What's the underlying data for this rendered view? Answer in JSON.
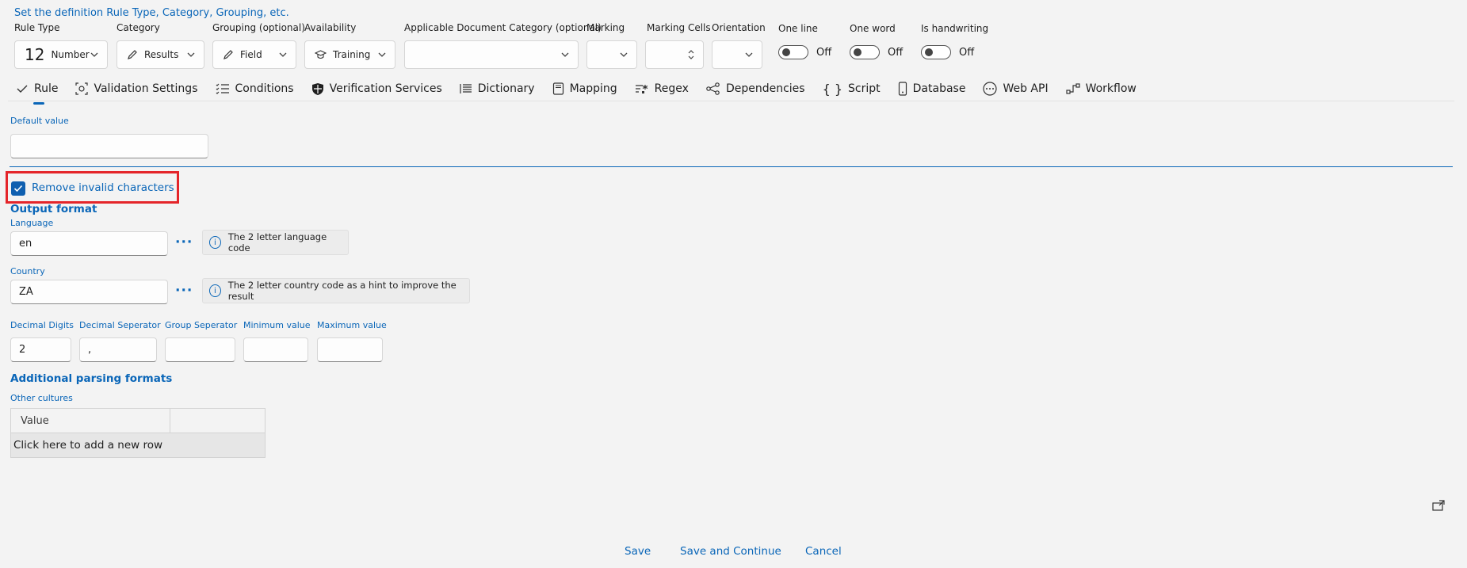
{
  "header": {
    "title": "Set the definition Rule Type, Category, Grouping, etc."
  },
  "fields": {
    "rule_type": {
      "label": "Rule Type",
      "value": "Number",
      "icon": "number-12-icon"
    },
    "category": {
      "label": "Category",
      "value": "Results",
      "icon": "pencil-icon"
    },
    "grouping": {
      "label": "Grouping (optional)",
      "value": "Field",
      "icon": "pencil-icon"
    },
    "availability": {
      "label": "Availability",
      "value": "Training",
      "icon": "graduation-cap-icon"
    },
    "doc_category": {
      "label": "Applicable Document Category (optional)",
      "value": ""
    },
    "marking": {
      "label": "Marking",
      "value": ""
    },
    "marking_cells": {
      "label": "Marking Cells",
      "value": ""
    },
    "orientation": {
      "label": "Orientation",
      "value": ""
    },
    "one_line": {
      "label": "One line",
      "state": "Off"
    },
    "one_word": {
      "label": "One word",
      "state": "Off"
    },
    "handwriting": {
      "label": "Is handwriting",
      "state": "Off"
    }
  },
  "tabs": [
    {
      "label": "Rule",
      "icon": "check-icon",
      "active": true
    },
    {
      "label": "Validation Settings",
      "icon": "validation-icon"
    },
    {
      "label": "Conditions",
      "icon": "list-check-icon"
    },
    {
      "label": "Verification Services",
      "icon": "shield-icon"
    },
    {
      "label": "Dictionary",
      "icon": "list-icon"
    },
    {
      "label": "Mapping",
      "icon": "book-icon"
    },
    {
      "label": "Regex",
      "icon": "regex-icon"
    },
    {
      "label": "Dependencies",
      "icon": "share-icon"
    },
    {
      "label": "Script",
      "icon": "braces-icon"
    },
    {
      "label": "Database",
      "icon": "database-icon"
    },
    {
      "label": "Web API",
      "icon": "web-api-icon"
    },
    {
      "label": "Workflow",
      "icon": "workflow-icon"
    }
  ],
  "default_value": {
    "label": "Default value",
    "value": ""
  },
  "remove_invalid": {
    "label": "Remove invalid characters",
    "checked": true
  },
  "output_format": {
    "title": "Output format",
    "language": {
      "label": "Language",
      "value": "en",
      "info": "The 2 letter language code"
    },
    "country": {
      "label": "Country",
      "value": "ZA",
      "info": "The 2 letter country code as a hint to improve the result"
    },
    "decimal_digits": {
      "label": "Decimal Digits",
      "value": "2"
    },
    "decimal_separator": {
      "label": "Decimal Seperator",
      "value": ","
    },
    "group_separator": {
      "label": "Group Seperator",
      "value": ""
    },
    "minimum": {
      "label": "Minimum value",
      "value": ""
    },
    "maximum": {
      "label": "Maximum value",
      "value": ""
    }
  },
  "parsing": {
    "title": "Additional parsing formats",
    "other_cultures_label": "Other cultures",
    "columns": [
      "Value",
      ""
    ],
    "add_row": "Click here to add a new row"
  },
  "footer": {
    "save": "Save",
    "save_continue": "Save and Continue",
    "cancel": "Cancel"
  },
  "colors": {
    "accent": "#0a66b8",
    "highlight": "#e4252a",
    "background": "#f3f3f3"
  }
}
